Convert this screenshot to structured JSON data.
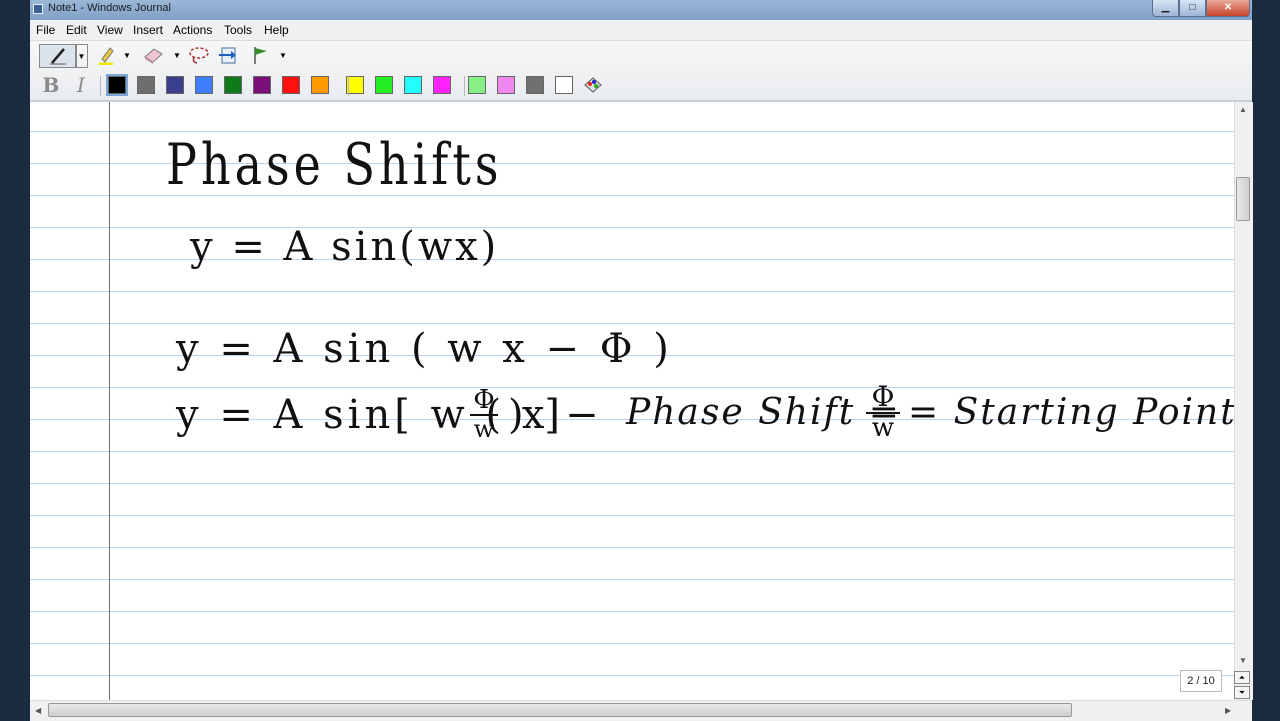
{
  "window": {
    "title": "Note1 - Windows Journal"
  },
  "menu": [
    "File",
    "Edit",
    "View",
    "Insert",
    "Actions",
    "Tools",
    "Help"
  ],
  "toolbar": {
    "tools": [
      "pen-icon",
      "highlighter-icon",
      "eraser-icon",
      "lasso-icon",
      "insert-space-icon",
      "flag-icon"
    ],
    "bold_label": "B",
    "italic_label": "I",
    "colors": [
      "#000000",
      "#6e6e6e",
      "#3a3f8c",
      "#3f7fff",
      "#0f7a1a",
      "#7a0f7a",
      "#ff1010",
      "#ff9a00",
      "#ffff00",
      "#22ee22",
      "#22ffff",
      "#ff22ff",
      "#88ee88",
      "#ee88ee",
      "#707070",
      "#ffffff"
    ]
  },
  "note": {
    "heading": "Phase Shifts",
    "eq1": "y = A sin(wx)",
    "eq2": "y = A sin ( w x − Φ )",
    "eq3_left": "y = A sin[ w ( x −",
    "eq3_frac_num": "Φ",
    "eq3_frac_den": "w",
    "eq3_right": ") ]",
    "phase_label": "Phase Shift =",
    "phase_frac_num": "Φ",
    "phase_frac_den": "w",
    "phase_result": "= Starting Point"
  },
  "status": {
    "page_indicator": "2 / 10"
  }
}
